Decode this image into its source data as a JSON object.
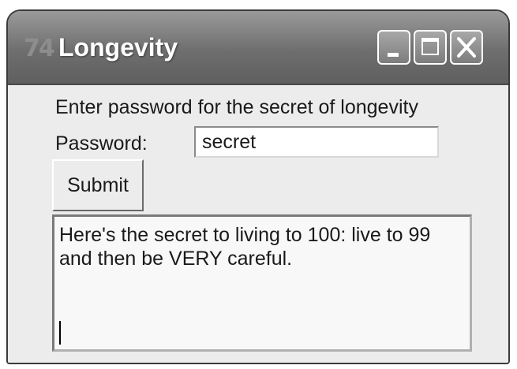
{
  "window": {
    "title": "Longevity",
    "icon_name": "tk-feather-icon",
    "icon_glyph": "74",
    "controls": [
      "minimize",
      "maximize",
      "close"
    ]
  },
  "form": {
    "prompt": "Enter password for the secret of longevity",
    "password_label": "Password:",
    "password_value": "secret",
    "submit_label": "Submit"
  },
  "output": {
    "line1": "Here's the secret to living to 100: live to 99",
    "line2": "and then be VERY careful."
  }
}
